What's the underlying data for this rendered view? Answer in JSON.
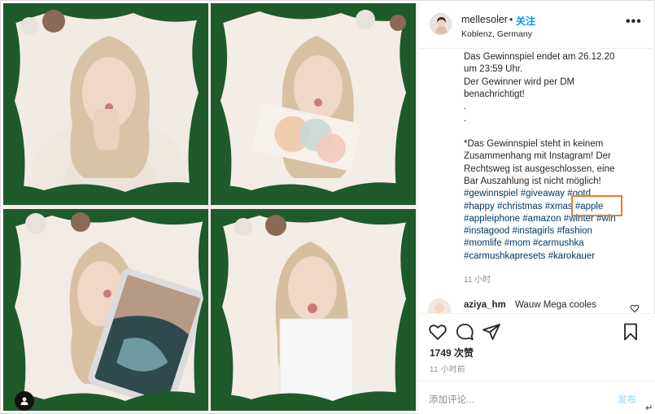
{
  "post": {
    "username": "mellesoler",
    "separator": "•",
    "follow_label": "关注",
    "location": "Koblenz, Germany",
    "more_label": "•••"
  },
  "caption_lines": [
    {
      "text": "Das Gewinnspiel endet am 26.12.20"
    },
    {
      "text": "um 23:59 Uhr."
    },
    {
      "text": "Der Gewinner wird per DM"
    },
    {
      "text": "benachrichtigt!"
    },
    {
      "text": "."
    },
    {
      "text": "."
    },
    {
      "text": ""
    },
    {
      "text": "*Das Gewinnspiel steht in keinem"
    },
    {
      "text": "Zusammenhang mit Instagram! Der"
    },
    {
      "text": "Rechtsweg ist ausgeschlossen, eine"
    },
    {
      "text": "Bar Auszahlung ist nicht möglich!"
    }
  ],
  "hashtag_lines": [
    [
      "#gewinnspiel",
      "#giveaway",
      "#ootd"
    ],
    [
      "#happy",
      "#christmas",
      "#xmas",
      "#apple"
    ],
    [
      "#appleiphone",
      "#amazon",
      "#winter",
      "#win"
    ],
    [
      "#instagood",
      "#instagirls",
      "#fashion"
    ],
    [
      "#momlife",
      "#mom",
      "#carmushka"
    ],
    [
      "#carmushkapresets",
      "#karokauer"
    ]
  ],
  "caption_time": "11 小时",
  "comment": {
    "username": "aziya_hm",
    "text": "Wauw Mega cooles"
  },
  "likes": "1749 次赞",
  "time_ago": "11 小时前",
  "add_comment": {
    "placeholder": "添加评论...",
    "post_label": "发布"
  },
  "icons": {
    "like": "heart-icon",
    "comment": "comment-bubble-icon",
    "share": "paper-plane-icon",
    "save": "bookmark-icon",
    "tagged": "person-icon"
  },
  "colors": {
    "link": "#00376b",
    "follow": "#0095f6",
    "post_disabled": "#b2dffc",
    "highlight": "#f07a2a"
  }
}
